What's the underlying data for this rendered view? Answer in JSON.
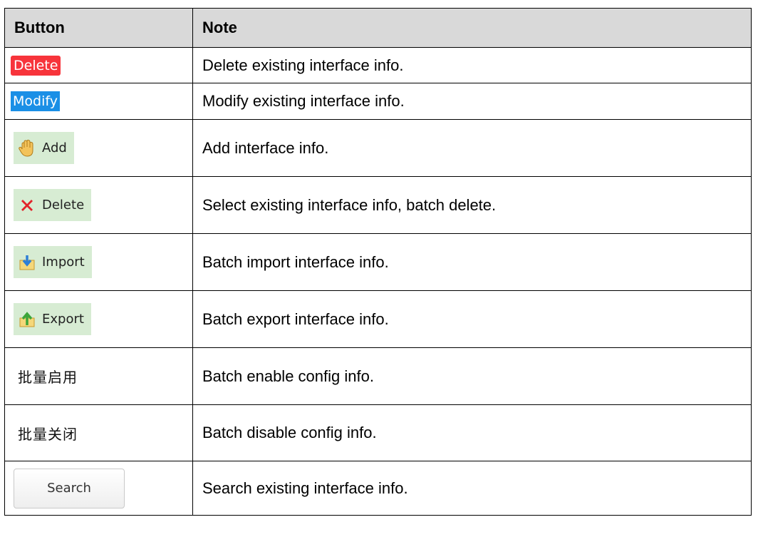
{
  "table": {
    "headers": {
      "button": "Button",
      "note": "Note"
    },
    "rows": [
      {
        "button_label": "Delete",
        "note": "Delete existing interface info."
      },
      {
        "button_label": "Modify",
        "note": "Modify existing interface info."
      },
      {
        "button_label": "Add",
        "icon": "hand-icon",
        "note": "Add interface info."
      },
      {
        "button_label": "Delete",
        "icon": "red-x-icon",
        "note": "Select existing interface info, batch delete."
      },
      {
        "button_label": "Import",
        "icon": "import-icon",
        "note": "Batch import interface info."
      },
      {
        "button_label": "Export",
        "icon": "export-icon",
        "note": "Batch export interface info."
      },
      {
        "button_label": "批量启用",
        "note": "Batch enable config info."
      },
      {
        "button_label": "批量关闭",
        "note": "Batch disable config info."
      },
      {
        "button_label": "Search",
        "note": "Search existing interface info."
      }
    ]
  },
  "colors": {
    "header_bg": "#d9d9d9",
    "delete_red": "#f7343b",
    "modify_blue": "#1a8fe6",
    "toolbar_green": "#d7ecd3"
  }
}
